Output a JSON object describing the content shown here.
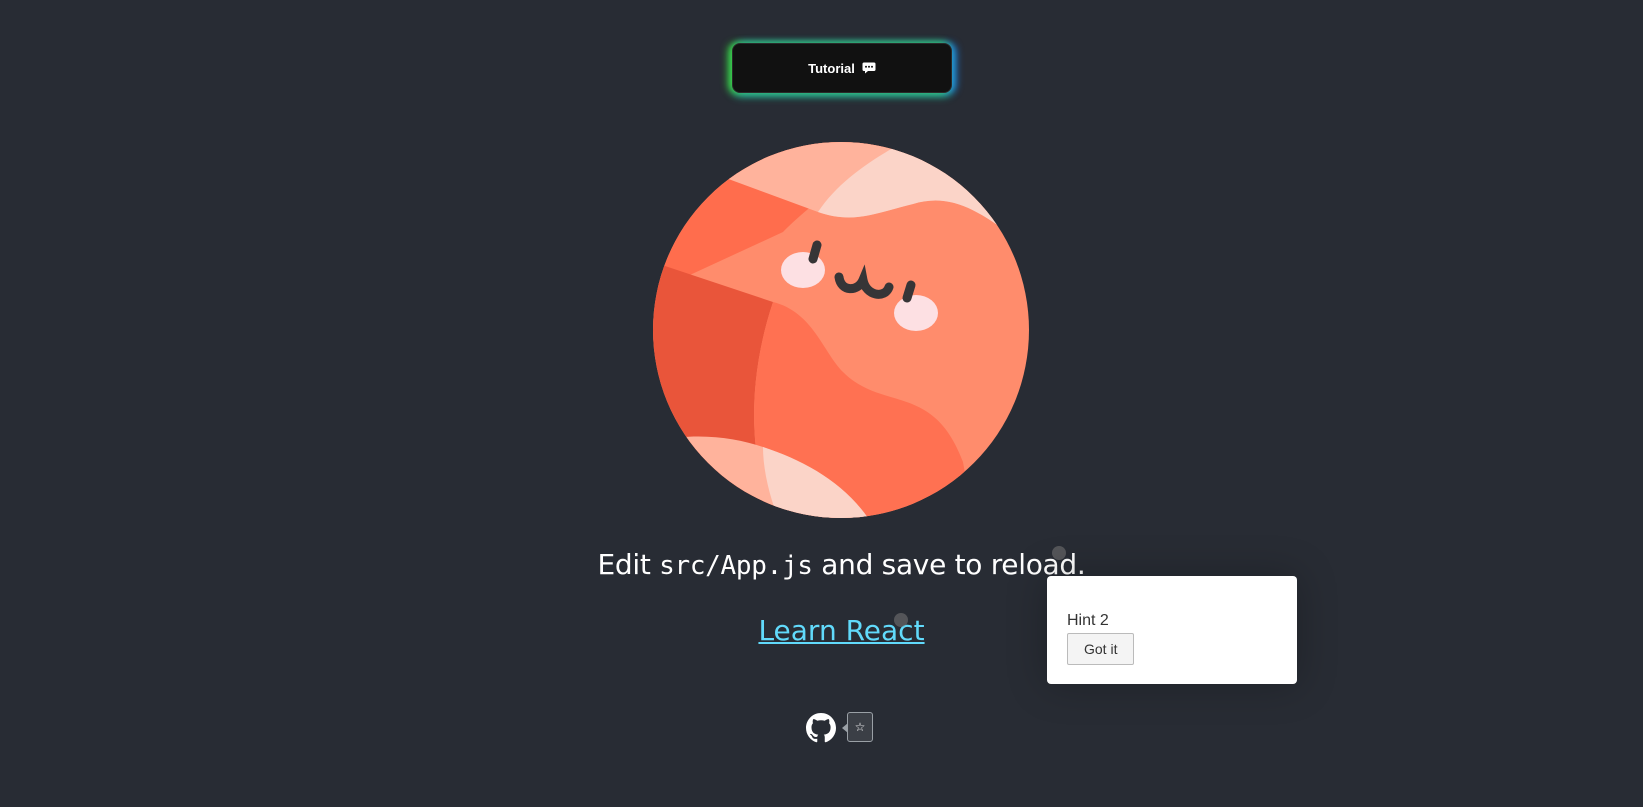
{
  "tutorial_button": {
    "label": "Tutorial",
    "icon": "chat-bubble-icon"
  },
  "edit_text": {
    "prefix": "Edit ",
    "code": "src/App.js",
    "suffix": " and save to reload."
  },
  "learn_link": {
    "label": "Learn React"
  },
  "hint": {
    "title": "Hint 2",
    "button_label": "Got it"
  },
  "github": {
    "icon": "github-icon",
    "star_button": "☆"
  },
  "colors": {
    "background": "#282c34",
    "link": "#61dafb",
    "planet_main": "#ff8a6e",
    "planet_dark": "#e9533a"
  }
}
